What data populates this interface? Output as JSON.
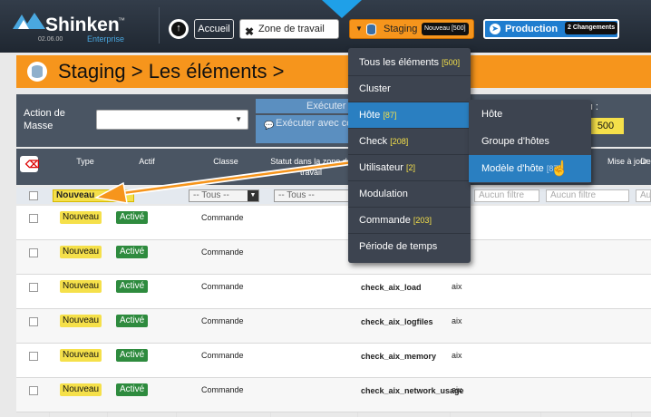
{
  "app": {
    "logo_name": "Shinken",
    "logo_tm": "™",
    "logo_version": "02.06.00",
    "logo_subtitle": "Enterprise"
  },
  "toolbar": {
    "up_icon": "arrow-up-icon",
    "accueil_label": "Accueil",
    "zone_label": "Zone de travail",
    "staging_label": "Staging",
    "staging_badge": "Nouveau [500]",
    "production_label": "Production",
    "production_badge": "2 Changements"
  },
  "title": {
    "text": "Staging > Les éléments >"
  },
  "actions": {
    "mass_action_label": "Action de Masse",
    "execute_label": "Exécuter",
    "execute_comment_label": "Exécuter avec commentaire",
    "right_label": "veau :",
    "right_count": "500"
  },
  "table": {
    "headers": {
      "type": "Type",
      "actif": "Actif",
      "classe": "Classe",
      "statut": "Statut dans la zone de travail",
      "mise_a_jour": "Mise à jour",
      "de": "De"
    },
    "filters": {
      "type_value": "Nouveau",
      "actif_value": "-- Tous --",
      "classe_value": "-- Tous --",
      "placeholder": "Aucun filtre",
      "placeholder_partial": "Auc"
    },
    "rows": [
      {
        "type": "Nouveau",
        "actif": "Activé",
        "classe": "Commande",
        "name": "",
        "tag": ""
      },
      {
        "type": "Nouveau",
        "actif": "Activé",
        "classe": "Commande",
        "name": "",
        "tag": ""
      },
      {
        "type": "Nouveau",
        "actif": "Activé",
        "classe": "Commande",
        "name": "check_aix_load",
        "tag": "aix"
      },
      {
        "type": "Nouveau",
        "actif": "Activé",
        "classe": "Commande",
        "name": "check_aix_logfiles",
        "tag": "aix"
      },
      {
        "type": "Nouveau",
        "actif": "Activé",
        "classe": "Commande",
        "name": "check_aix_memory",
        "tag": "aix"
      },
      {
        "type": "Nouveau",
        "actif": "Activé",
        "classe": "Commande",
        "name": "check_aix_network_usage",
        "tag": "aix"
      }
    ]
  },
  "menu": {
    "items": [
      {
        "label": "Tous les éléments",
        "count": "[500]"
      },
      {
        "label": "Cluster",
        "count": ""
      },
      {
        "label": "Hôte",
        "count": "[87]"
      },
      {
        "label": "Check",
        "count": "[208]"
      },
      {
        "label": "Utilisateur",
        "count": "[2]"
      },
      {
        "label": "Modulation",
        "count": ""
      },
      {
        "label": "Commande",
        "count": "[203]"
      },
      {
        "label": "Période de temps",
        "count": ""
      }
    ],
    "submenu": [
      {
        "label": "Hôte",
        "count": ""
      },
      {
        "label": "Groupe d'hôtes",
        "count": ""
      },
      {
        "label": "Modèle d'hôte",
        "count": "[87]"
      }
    ]
  },
  "colors": {
    "staging_orange": "#f6951c",
    "production_blue": "#1f7dcf",
    "menu_selected": "#2a7fc1",
    "badge_yellow": "#f5e04a",
    "active_green": "#2e8b3e"
  }
}
